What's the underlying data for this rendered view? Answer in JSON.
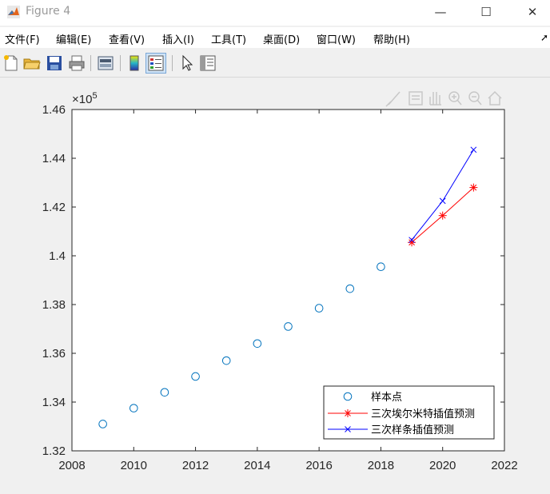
{
  "window": {
    "title": "Figure 4",
    "controls": [
      "—",
      "☐",
      "✕"
    ]
  },
  "menu": {
    "items": [
      "文件(F)",
      "编辑(E)",
      "查看(V)",
      "插入(I)",
      "工具(T)",
      "桌面(D)",
      "窗口(W)",
      "帮助(H)"
    ],
    "overflow": "➚"
  },
  "toolbar": {
    "buttons": [
      "new-figure-icon",
      "open-file-icon",
      "save-icon",
      "print-icon",
      "link-plot-icon",
      "colorbar-icon",
      "legend-icon",
      "edit-plot-arrow-icon",
      "property-inspector-icon"
    ]
  },
  "axes_toolbar": {
    "buttons": [
      "brush-icon",
      "data-tip-icon",
      "pan-hand-icon",
      "zoom-in-icon",
      "zoom-out-icon",
      "home-icon"
    ]
  },
  "chart_data": {
    "type": "line",
    "title": "",
    "xlabel": "",
    "ylabel": "",
    "xlim": [
      2008,
      2022
    ],
    "ylim": [
      132000,
      146000
    ],
    "xticks": [
      2008,
      2010,
      2012,
      2014,
      2016,
      2018,
      2020,
      2022
    ],
    "xtick_labels": [
      "2008",
      "2010",
      "2012",
      "2014",
      "2016",
      "2018",
      "2020",
      "2022"
    ],
    "yticks": [
      132000,
      134000,
      136000,
      138000,
      140000,
      142000,
      144000,
      146000
    ],
    "ytick_labels": [
      "1.32",
      "1.34",
      "1.36",
      "1.38",
      "1.4",
      "1.42",
      "1.44",
      "1.46"
    ],
    "y_exponent_label": "×10",
    "y_exponent_power": "5",
    "grid": false,
    "legend_position": "bottom-right",
    "series": [
      {
        "name": "样本点",
        "style": "markers",
        "marker": "circle",
        "color": "#0072bd",
        "x": [
          2009,
          2010,
          2011,
          2012,
          2013,
          2014,
          2015,
          2016,
          2017,
          2018
        ],
        "y": [
          133100,
          133750,
          134400,
          135050,
          135700,
          136400,
          137100,
          137850,
          138650,
          139550
        ]
      },
      {
        "name": "三次埃尔米特插值预测",
        "style": "line-markers",
        "marker": "asterisk",
        "color": "#ff0000",
        "x": [
          2019,
          2020,
          2021
        ],
        "y": [
          140550,
          141650,
          142800
        ]
      },
      {
        "name": "三次样条插值预测",
        "style": "line-markers",
        "marker": "x",
        "color": "#0000ff",
        "x": [
          2019,
          2020,
          2021
        ],
        "y": [
          140650,
          142250,
          144350
        ]
      }
    ]
  }
}
